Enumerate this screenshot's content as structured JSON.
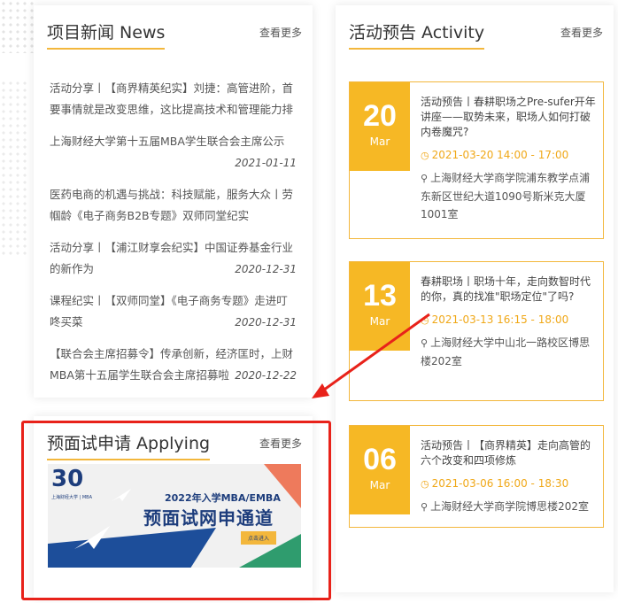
{
  "news": {
    "title": "项目新闻 News",
    "more": "查看更多",
    "items": [
      {
        "title": "活动分享丨【商界精英纪实】刘捷：高管进阶，首要事情就是改变思维，这比提高技术和管理能力排",
        "date": ""
      },
      {
        "title": "上海财经大学第十五届MBA学生联合会主席公示",
        "date": "2021-01-11"
      },
      {
        "title": "医药电商的机遇与挑战：科技赋能，服务大众丨劳帼龄《电子商务B2B专题》双师同堂纪实",
        "date": ""
      },
      {
        "title": "活动分享丨【浦江财享会纪实】中国证券基金行业的新作为",
        "date": "2020-12-31"
      },
      {
        "title": "课程纪实丨【双师同堂】《电子商务专题》走进叮咚买菜",
        "date": "2020-12-31"
      },
      {
        "title": "【联合会主席招募令】传承创新，经济匡时，上财MBA第十五届学生联合会主席招募啦",
        "date": "2020-12-22"
      }
    ]
  },
  "apply": {
    "title": "预面试申请 Applying",
    "more": "查看更多",
    "banner": {
      "logo": "30",
      "logo_sub": "上海财经大学 | MBA",
      "line1": "2022年入学MBA/EMBA",
      "line2": "预面试网申通道",
      "button": "点击进入"
    }
  },
  "activity": {
    "title": "活动预告 Activity",
    "more": "查看更多",
    "items": [
      {
        "day": "20",
        "month": "Mar",
        "title": "活动预告丨春耕职场之Pre-sufer开年讲座——取势未来，职场人如何打破内卷魔咒?",
        "time": "2021-03-20 14:00 - 17:00",
        "location": "上海财经大学商学院浦东教学点浦东新区世纪大道1090号斯米克大厦1001室"
      },
      {
        "day": "13",
        "month": "Mar",
        "title": "春耕职场丨职场十年，走向数智时代的你，真的找准\"职场定位\"了吗?",
        "time": "2021-03-13 16:15 - 18:00",
        "location": "上海财经大学中山北一路校区博思楼202室"
      },
      {
        "day": "06",
        "month": "Mar",
        "title": "活动预告丨【商界精英】走向高管的六个改变和四项修炼",
        "time": "2021-03-06 16:00 - 18:30",
        "location": "上海财经大学商学院博思楼202室"
      }
    ]
  },
  "colors": {
    "accent": "#f6b825",
    "highlight": "#e8221a",
    "banner_blue": "#1d4e9a"
  }
}
